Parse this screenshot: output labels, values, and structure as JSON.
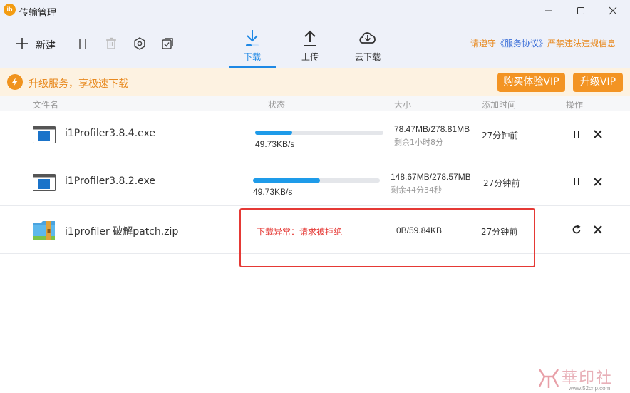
{
  "window": {
    "app_logo_text": "ib",
    "title": "传输管理",
    "controls": [
      "minimize-icon",
      "maximize-icon",
      "close-icon"
    ]
  },
  "toolbar": {
    "new_label": "新建",
    "actions": [
      "pause-all-icon",
      "delete-icon",
      "settings-icon",
      "select-all-icon"
    ],
    "tabs": [
      {
        "label": "下载",
        "icon": "download-icon",
        "active": true
      },
      {
        "label": "上传",
        "icon": "upload-icon",
        "active": false
      },
      {
        "label": "云下载",
        "icon": "cloud-download-icon",
        "active": false
      }
    ],
    "terms": {
      "prefix": "请遵守",
      "link": "《服务协议》",
      "suffix": "严禁违法违规信息"
    }
  },
  "promo": {
    "text": "升级服务，享极速下载",
    "trial_vip_label": "购买体验VIP",
    "upgrade_vip_label": "升级VIP"
  },
  "columns": {
    "name": "文件名",
    "status": "状态",
    "size": "大小",
    "added": "添加时间",
    "actions": "操作"
  },
  "rows": [
    {
      "name": "i1Profiler3.8.4.exe",
      "icon": "exe-file-icon",
      "progress": 0.29,
      "speed": "49.73KB/s",
      "size": "78.47MB/278.81MB",
      "remaining": "剩余1小时8分",
      "added": "27分钟前",
      "actions": [
        "pause-icon",
        "close-icon"
      ]
    },
    {
      "name": "i1Profiler3.8.2.exe",
      "icon": "exe-file-icon",
      "progress": 0.53,
      "speed": "49.73KB/s",
      "size": "148.67MB/278.57MB",
      "remaining": "剩余44分34秒",
      "added": "27分钟前",
      "actions": [
        "pause-icon",
        "close-icon"
      ]
    },
    {
      "name": "i1profiler 破解patch.zip",
      "icon": "zip-file-icon",
      "error": "下载异常：请求被拒绝",
      "size": "0B/59.84KB",
      "added": "27分钟前",
      "actions": [
        "retry-icon",
        "close-icon"
      ]
    }
  ],
  "watermark": {
    "text": "華印社區",
    "url": "www.52cnp.com"
  },
  "colors": {
    "accent": "#1e88e5",
    "vip_orange": "#f39423",
    "promo_bg": "#fdf2e1",
    "error_red": "#e53935",
    "progress_blue": "#1e9be9"
  }
}
